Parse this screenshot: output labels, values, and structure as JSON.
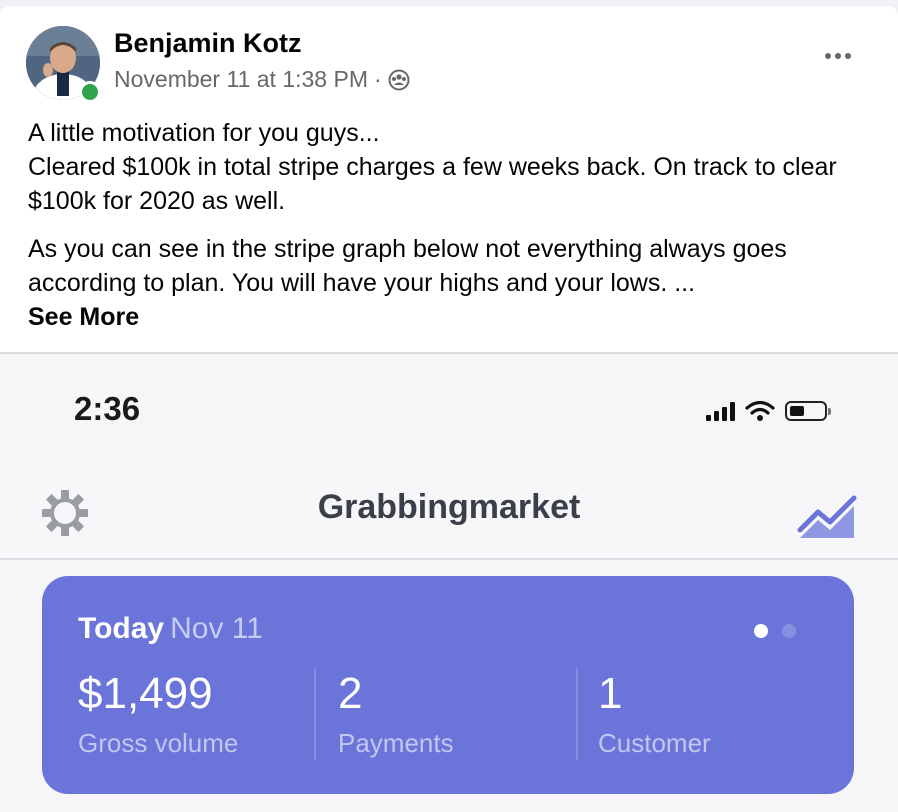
{
  "post": {
    "author": "Benjamin Kotz",
    "timestamp": "November 11 at 1:38 PM",
    "separator": "·",
    "privacy_icon": "group-icon",
    "more_icon": "more-options-icon",
    "paragraphs": [
      "A little motivation for you guys...",
      "Cleared $100k in total stripe charges a few weeks back. On track to clear $100k for 2020 as well.",
      "As you can see in the stripe graph below not everything always goes according to plan. You will have your highs and your lows. ..."
    ],
    "see_more": "See More"
  },
  "phone": {
    "time": "2:36",
    "status_icons": [
      "signal-icon",
      "wifi-icon",
      "battery-icon"
    ]
  },
  "app": {
    "title": "Grabbingmarket",
    "left_icon": "gear-icon",
    "right_icon": "trend-chart-icon"
  },
  "summary": {
    "label": "Today",
    "date": "Nov 11",
    "stats": [
      {
        "value": "$1,499",
        "label": "Gross volume"
      },
      {
        "value": "2",
        "label": "Payments"
      },
      {
        "value": "1",
        "label": "Customer"
      }
    ],
    "pager_active_index": 0,
    "pager_count": 2
  },
  "colors": {
    "card": "#6a74d9",
    "online": "#31a24c",
    "meta_text": "#65676b"
  }
}
